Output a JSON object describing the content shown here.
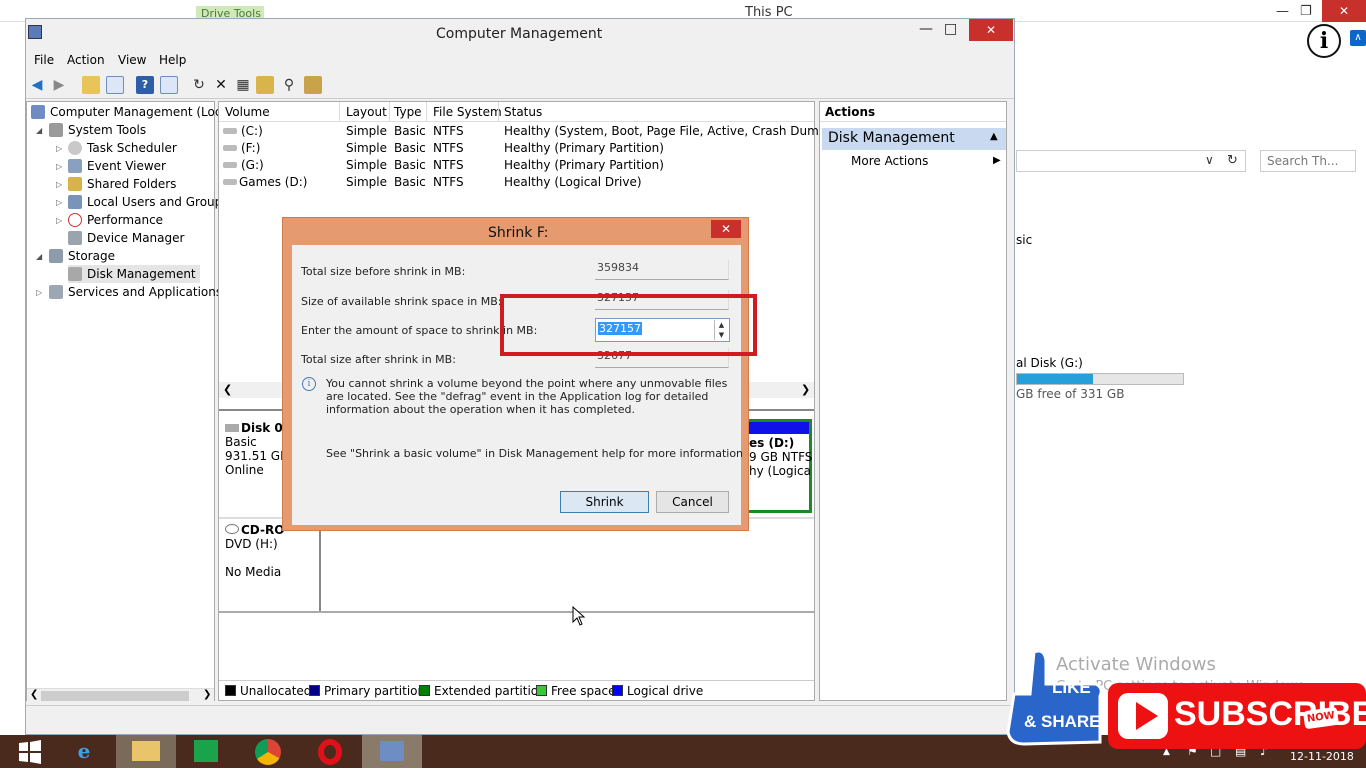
{
  "background_window": {
    "ribbon_tab": "Drive Tools",
    "title": "This PC",
    "search_placeholder": "Search Th...",
    "partial_text_1": "sic",
    "partial_disk_label": "al Disk (G:)",
    "partial_disk_free": "GB free of 331 GB",
    "disk_fill_fraction": 0.46
  },
  "watermark": {
    "line1": "Activate Windows",
    "line2": "Go to PC settings to activate Windows."
  },
  "window": {
    "title": "Computer Management"
  },
  "menubar": [
    "File",
    "Action",
    "View",
    "Help"
  ],
  "tree": {
    "root": "Computer Management (Local",
    "items": [
      {
        "label": "System Tools",
        "level": 1,
        "expander": "◢"
      },
      {
        "label": "Task Scheduler",
        "level": 2,
        "expander": "▷"
      },
      {
        "label": "Event Viewer",
        "level": 2,
        "expander": "▷"
      },
      {
        "label": "Shared Folders",
        "level": 2,
        "expander": "▷"
      },
      {
        "label": "Local Users and Groups",
        "level": 2,
        "expander": "▷"
      },
      {
        "label": "Performance",
        "level": 2,
        "expander": "▷"
      },
      {
        "label": "Device Manager",
        "level": 2,
        "expander": ""
      },
      {
        "label": "Storage",
        "level": 1,
        "expander": "◢"
      },
      {
        "label": "Disk Management",
        "level": 2,
        "expander": ""
      },
      {
        "label": "Services and Applications",
        "level": 1,
        "expander": "▷"
      }
    ]
  },
  "volumes": {
    "headers": [
      "Volume",
      "Layout",
      "Type",
      "File System",
      "Status"
    ],
    "rows": [
      [
        "(C:)",
        "Simple",
        "Basic",
        "NTFS",
        "Healthy (System, Boot, Page File, Active, Crash Dump, Prim"
      ],
      [
        "(F:)",
        "Simple",
        "Basic",
        "NTFS",
        "Healthy (Primary Partition)"
      ],
      [
        "(G:)",
        "Simple",
        "Basic",
        "NTFS",
        "Healthy (Primary Partition)"
      ],
      [
        "Games (D:)",
        "Simple",
        "Basic",
        "NTFS",
        "Healthy (Logical Drive)"
      ]
    ]
  },
  "disks": {
    "disk0": {
      "name": "Disk 0",
      "type": "Basic",
      "size": "931.51 GB",
      "status": "Online"
    },
    "cdrom": {
      "name": "CD-RO",
      "drive": "DVD (H:)",
      "status": "No Media"
    },
    "partial_partition": {
      "line1": "es  (D:)",
      "line2": "9 GB NTFS",
      "line3": "hy (Logica"
    }
  },
  "legend": [
    {
      "label": "Unallocated",
      "color": "#000000"
    },
    {
      "label": "Primary partition",
      "color": "#00008b"
    },
    {
      "label": "Extended partition",
      "color": "#008000"
    },
    {
      "label": "Free space",
      "color": "#33cc33"
    },
    {
      "label": "Logical drive",
      "color": "#0000ff"
    }
  ],
  "actions": {
    "header": "Actions",
    "section": "Disk Management",
    "more": "More Actions"
  },
  "dialog": {
    "title": "Shrink F:",
    "rows": [
      {
        "label": "Total size before shrink in MB:",
        "value": "359834"
      },
      {
        "label": "Size of available shrink space in MB:",
        "value": "327157"
      },
      {
        "label": "Enter the amount of space to shrink in MB:",
        "value": "327157"
      },
      {
        "label": "Total size after shrink in MB:",
        "value": "32677"
      }
    ],
    "info": "You cannot shrink a volume beyond the point where any unmovable files are located. See the \"defrag\" event in the Application log for detailed information about the operation when it has completed.",
    "help": "See \"Shrink a basic volume\" in Disk Management help for more information",
    "shrink_button": "Shrink",
    "cancel_button": "Cancel"
  },
  "taskbar": {
    "date": "12-11-2018"
  },
  "overlays": {
    "like_line1": "LIKE",
    "like_line2": "& SHARE",
    "subscribe": "SUBSCRIBE",
    "now": "NOW"
  }
}
